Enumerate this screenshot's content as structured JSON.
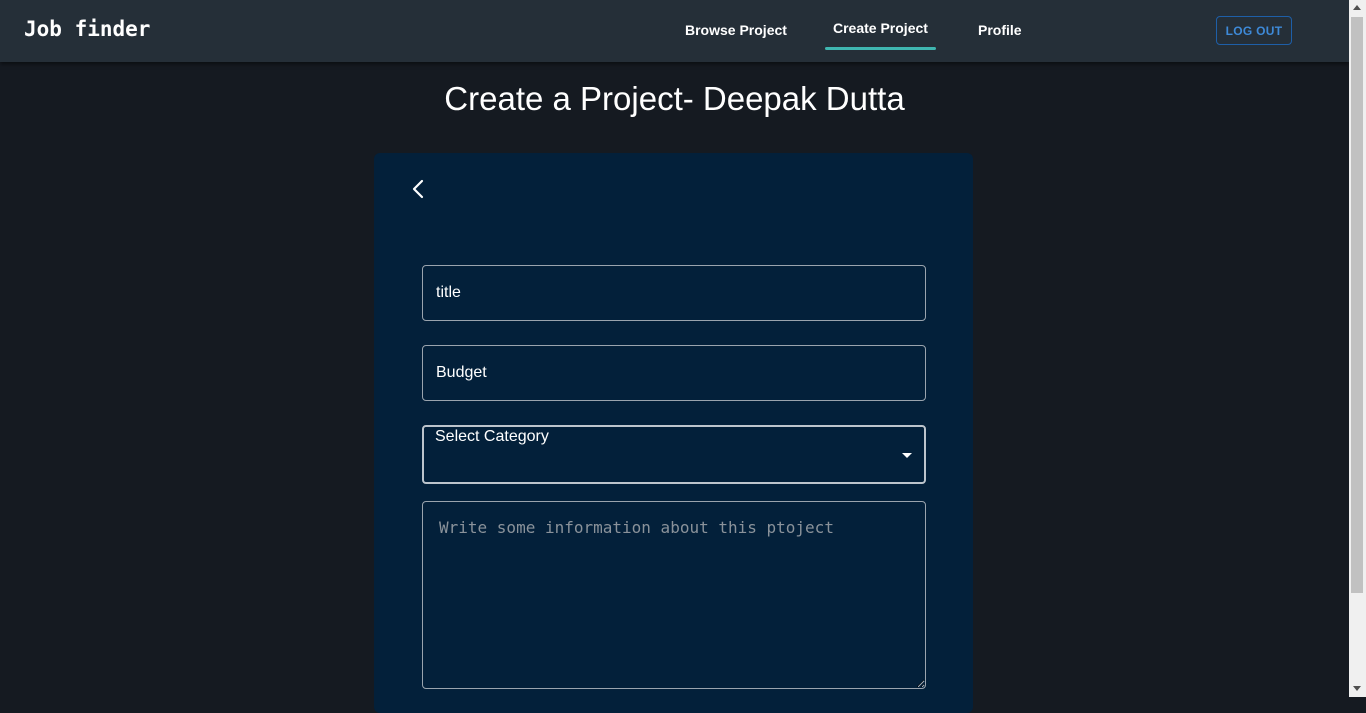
{
  "header": {
    "brand": "Job finder",
    "nav": {
      "browse": "Browse Project",
      "create": "Create Project",
      "profile": "Profile"
    },
    "logout_label": "LOG OUT",
    "active_tab": "Create Project"
  },
  "page": {
    "title": "Create a Project- Deepak Dutta"
  },
  "form": {
    "back_icon": "chevron-left-icon",
    "title_value": "title",
    "budget_value": "Budget",
    "category_label": "Select Category",
    "description_placeholder": "Write some information about this ptoject"
  },
  "colors": {
    "background": "#151a21",
    "navbar": "#252f38",
    "card": "#03203a",
    "accent": "#3fb6b0",
    "logout": "#3e8ad8"
  }
}
